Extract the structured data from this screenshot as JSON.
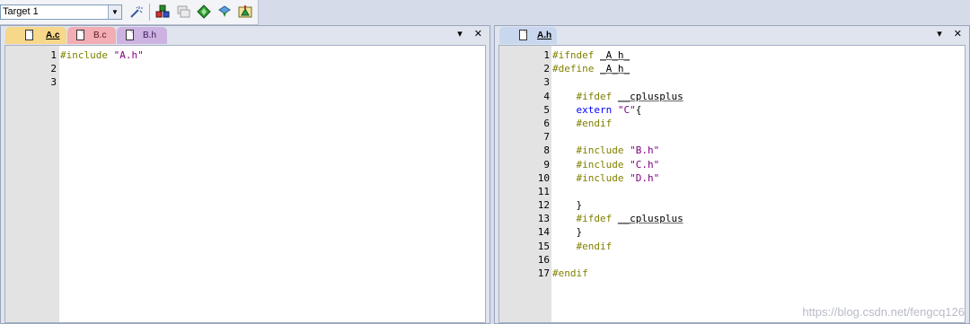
{
  "toolbar": {
    "target_value": "Target 1",
    "icons": [
      "build-target-icon",
      "load-flash-icon",
      "batch-build-icon",
      "stop-build-icon",
      "download-icon",
      "options-target-icon"
    ]
  },
  "left_pane": {
    "tabs": [
      {
        "label": "A.c",
        "color": "#f7d789",
        "active": true
      },
      {
        "label": "B.c",
        "color": "#f2aeb4",
        "active": false
      },
      {
        "label": "B.h",
        "color": "#cdb3e2",
        "active": false
      }
    ],
    "dropdown_symbol": "▾",
    "close_symbol": "✕",
    "lines": [
      {
        "num": "1",
        "parts": [
          {
            "t": "#include ",
            "c": "pp"
          },
          {
            "t": "\"A.h\"",
            "c": "str"
          }
        ]
      },
      {
        "num": "2",
        "parts": []
      },
      {
        "num": "3",
        "parts": []
      }
    ]
  },
  "right_pane": {
    "tabs": [
      {
        "label": "A.h",
        "color": "#c9d7ee",
        "active": true
      }
    ],
    "dropdown_symbol": "▾",
    "close_symbol": "✕",
    "lines": [
      {
        "num": "1",
        "parts": [
          {
            "t": "#ifndef ",
            "c": "pp"
          },
          {
            "t": "_A_h_",
            "c": "ident"
          }
        ]
      },
      {
        "num": "2",
        "parts": [
          {
            "t": "#define ",
            "c": "pp"
          },
          {
            "t": "_A_h_",
            "c": "ident"
          }
        ]
      },
      {
        "num": "3",
        "parts": []
      },
      {
        "num": "4",
        "parts": [
          {
            "t": "    #ifdef ",
            "c": "pp"
          },
          {
            "t": "__cplusplus",
            "c": "ident"
          }
        ]
      },
      {
        "num": "5",
        "parts": [
          {
            "t": "    extern ",
            "c": "kw"
          },
          {
            "t": "\"C\"",
            "c": "str"
          },
          {
            "t": "{",
            "c": "plain"
          }
        ]
      },
      {
        "num": "6",
        "parts": [
          {
            "t": "    #endif",
            "c": "pp"
          }
        ]
      },
      {
        "num": "7",
        "parts": []
      },
      {
        "num": "8",
        "parts": [
          {
            "t": "    #include ",
            "c": "pp"
          },
          {
            "t": "\"B.h\"",
            "c": "str"
          }
        ]
      },
      {
        "num": "9",
        "parts": [
          {
            "t": "    #include ",
            "c": "pp"
          },
          {
            "t": "\"C.h\"",
            "c": "str"
          }
        ]
      },
      {
        "num": "10",
        "parts": [
          {
            "t": "    #include ",
            "c": "pp"
          },
          {
            "t": "\"D.h\"",
            "c": "str"
          }
        ]
      },
      {
        "num": "11",
        "parts": []
      },
      {
        "num": "12",
        "parts": [
          {
            "t": "    }",
            "c": "plain"
          }
        ]
      },
      {
        "num": "13",
        "parts": [
          {
            "t": "    #ifdef ",
            "c": "pp"
          },
          {
            "t": "__cplusplus",
            "c": "ident"
          }
        ]
      },
      {
        "num": "14",
        "parts": [
          {
            "t": "    }",
            "c": "plain"
          }
        ]
      },
      {
        "num": "15",
        "parts": [
          {
            "t": "    #endif",
            "c": "pp"
          }
        ]
      },
      {
        "num": "16",
        "parts": []
      },
      {
        "num": "17",
        "parts": [
          {
            "t": "#endif",
            "c": "pp"
          }
        ]
      }
    ]
  },
  "watermark": "https://blog.csdn.net/fengcq126"
}
